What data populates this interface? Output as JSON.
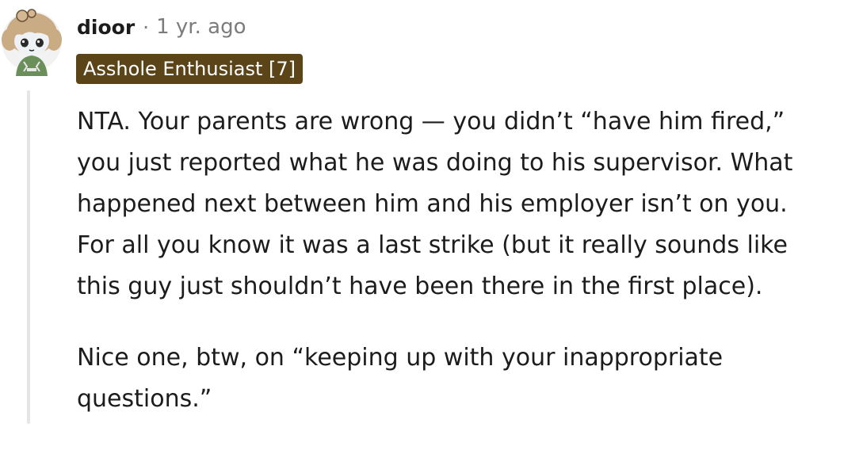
{
  "comment": {
    "username": "dioor",
    "separator": "·",
    "timestamp": "1 yr. ago",
    "flair": "Asshole Enthusiast [7]",
    "paragraphs": [
      {
        "lines": [
          "NTA. Your parents are wrong — you didn’t “have him fired,”",
          "you just reported what he was doing to his supervisor. What",
          "happened next between him and his employer isn’t on you.",
          "For all you know it was a last strike (but it really sounds like",
          "this guy just shouldn’t have been there in the first place)."
        ]
      },
      {
        "lines": [
          "Nice one, btw, on “keeping up with your inappropriate",
          "questions.”"
        ]
      }
    ]
  },
  "colors": {
    "flair_background": "#5c4419",
    "meta_gray": "#7c7c7c",
    "thread_line": "#e5e5e5"
  },
  "icons": {
    "avatar": "user-avatar-snoo-icon"
  }
}
